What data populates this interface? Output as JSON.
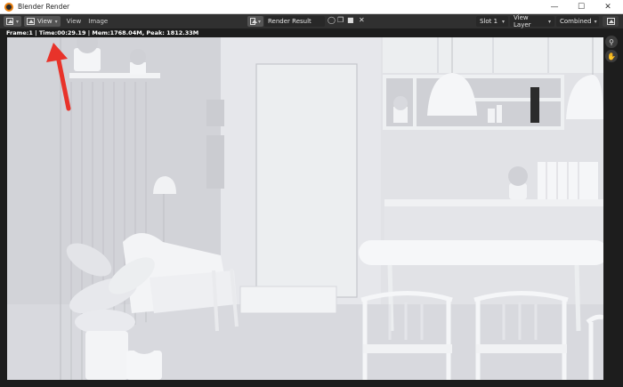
{
  "window": {
    "title": "Blender Render"
  },
  "header": {
    "view_menu": "View",
    "menus": [
      "View",
      "Image"
    ],
    "image_name": "Render Result",
    "slot": "Slot 1",
    "view_layer": "View Layer",
    "pass": "Combined"
  },
  "info": "Frame:1 | Time:00:29.19 | Mem:1768.04M, Peak: 1812.33M",
  "colors": {
    "annotation_arrow": "#e8332a",
    "header_bg": "#303030",
    "scene": "#e3e4e8"
  }
}
